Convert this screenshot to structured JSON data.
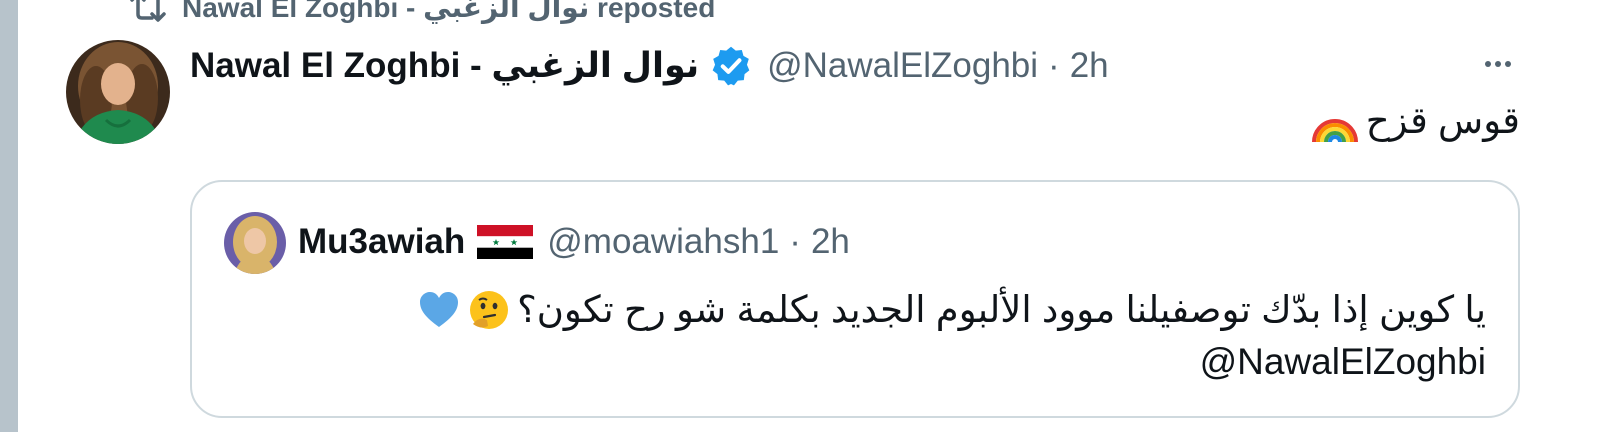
{
  "repost": {
    "label": "Nawal El Zoghbi - نوال الزغبي reposted",
    "icon": "repost-icon"
  },
  "tweet": {
    "author_name": "Nawal El Zoghbi - نوال الزغبي",
    "verified": true,
    "handle": "@NawalElZoghbi",
    "separator": "·",
    "time": "2h",
    "text": "قوس قزح",
    "text_emoji": "rainbow-emoji",
    "more_icon": "more-options-icon"
  },
  "quote": {
    "author_name": "Mu3awiah",
    "flag": "syria-flag-emoji",
    "handle": "@moawiahsh1",
    "separator": "·",
    "time": "2h",
    "text_line1": "يا كوين إذا بدّك توصفيلنا موود الألبوم الجديد بكلمة شو رح تكون؟",
    "line1_emojis": [
      "thinking-face-emoji",
      "blue-heart-emoji"
    ],
    "text_line2": "@NawalElZoghbi"
  },
  "colors": {
    "secondary_text": "#536471",
    "verified_blue": "#1d9bf0",
    "border": "#cfd9de",
    "left_bar": "#b7c3cb"
  }
}
